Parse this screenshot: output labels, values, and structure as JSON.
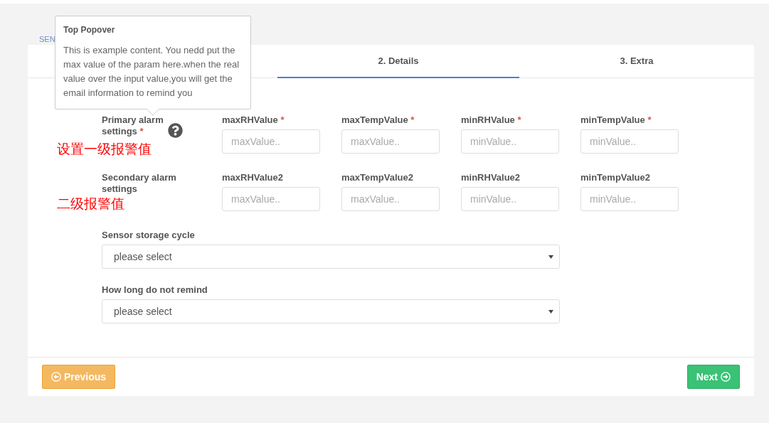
{
  "section_heading": "SEN",
  "popover": {
    "title": "Top Popover",
    "content": "This is example content. You nedd put the max value of the param here.when the real value over the input value,you will get the email information to remind you"
  },
  "tabs": [
    {
      "label": "2. Details",
      "selected": true
    },
    {
      "label": "3. Extra",
      "selected": false
    }
  ],
  "alarm_rows": [
    {
      "label": "Primary alarm settings",
      "mark": "*",
      "help": true,
      "annotation": "设置一级报警值",
      "fields": [
        {
          "label": "maxRHValue",
          "mark": "*",
          "placeholder": "maxValue.."
        },
        {
          "label": "maxTempValue",
          "mark": "*",
          "placeholder": "maxValue.."
        },
        {
          "label": "minRHValue",
          "mark": "*",
          "placeholder": "minValue.."
        },
        {
          "label": "minTempValue",
          "mark": "*",
          "placeholder": "minValue.."
        }
      ]
    },
    {
      "label": "Secondary alarm settings",
      "annotation": "二级报警值",
      "fields": [
        {
          "label": "maxRHValue2",
          "placeholder": "maxValue.."
        },
        {
          "label": "maxTempValue2",
          "placeholder": "maxValue.."
        },
        {
          "label": "minRHValue2",
          "placeholder": "minValue.."
        },
        {
          "label": "minTempValue2",
          "placeholder": "minValue.."
        }
      ]
    }
  ],
  "selects": [
    {
      "label": "Sensor storage cycle",
      "value": "please select"
    },
    {
      "label": "How long do not remind",
      "value": "please select"
    }
  ],
  "buttons": [
    {
      "label": "Previous",
      "kind": "previous"
    },
    {
      "label": "Next",
      "kind": "next"
    }
  ]
}
